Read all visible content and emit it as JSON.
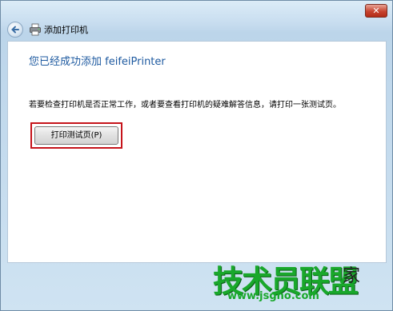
{
  "window": {
    "title": "添加打印机",
    "close_symbol": "✕"
  },
  "main": {
    "heading": "您已经成功添加 feifeiPrinter",
    "description": "若要检查打印机是否正常工作，或者要查看打印机的疑难解答信息，请打印一张测试页。",
    "print_test_label": "打印测试页(P)"
  },
  "watermark": {
    "brand": "技术员联盟",
    "suffix": "家",
    "url": "www.jsgho.com"
  },
  "icons": {
    "back": "back-arrow-icon",
    "printer": "printer-icon",
    "close": "close-icon"
  },
  "colors": {
    "heading": "#1e5aa0",
    "highlight_border": "#c6141b",
    "watermark_green": "#19a82b"
  }
}
